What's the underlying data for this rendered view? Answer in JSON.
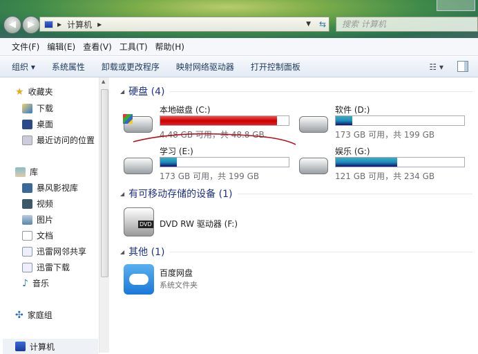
{
  "address": {
    "breadcrumb": "计算机",
    "search_placeholder": "搜索 计算机"
  },
  "menu": [
    "文件(F)",
    "编辑(E)",
    "查看(V)",
    "工具(T)",
    "帮助(H)"
  ],
  "toolbar": {
    "organize": "组织 ▾",
    "items": [
      "系统属性",
      "卸载或更改程序",
      "映射网络驱动器",
      "打开控制面板"
    ]
  },
  "sidebar": {
    "favorites": "收藏夹",
    "fav_items": [
      "下载",
      "桌面",
      "最近访问的位置"
    ],
    "library": "库",
    "lib_items": [
      "暴风影视库",
      "视频",
      "图片",
      "文档",
      "迅雷网邻共享",
      "迅雷下载",
      "音乐"
    ],
    "homegroup": "家庭组",
    "computer": "计算机"
  },
  "groups": {
    "hdd": "硬盘 (4)",
    "removable": "有可移动存储的设备 (1)",
    "other": "其他 (1)"
  },
  "drives": [
    {
      "name": "本地磁盘 (C:)",
      "info": "4.48 GB 可用，共 48.8 GB",
      "used_pct": 90.8,
      "color": "#cc0000"
    },
    {
      "name": "软件 (D:)",
      "info": "173 GB 可用，共 199 GB",
      "used_pct": 13,
      "color": "#1b8fbf"
    },
    {
      "name": "学习 (E:)",
      "info": "173 GB 可用，共 199 GB",
      "used_pct": 13,
      "color": "#1b8fbf"
    },
    {
      "name": "娱乐 (G:)",
      "info": "121 GB 可用，共 234 GB",
      "used_pct": 48,
      "color": "#1b8fbf"
    }
  ],
  "dvd": {
    "name": "DVD RW 驱动器 (F:)",
    "badge": "DVD"
  },
  "baidu": {
    "name": "百度网盘",
    "type": "系统文件夹"
  }
}
